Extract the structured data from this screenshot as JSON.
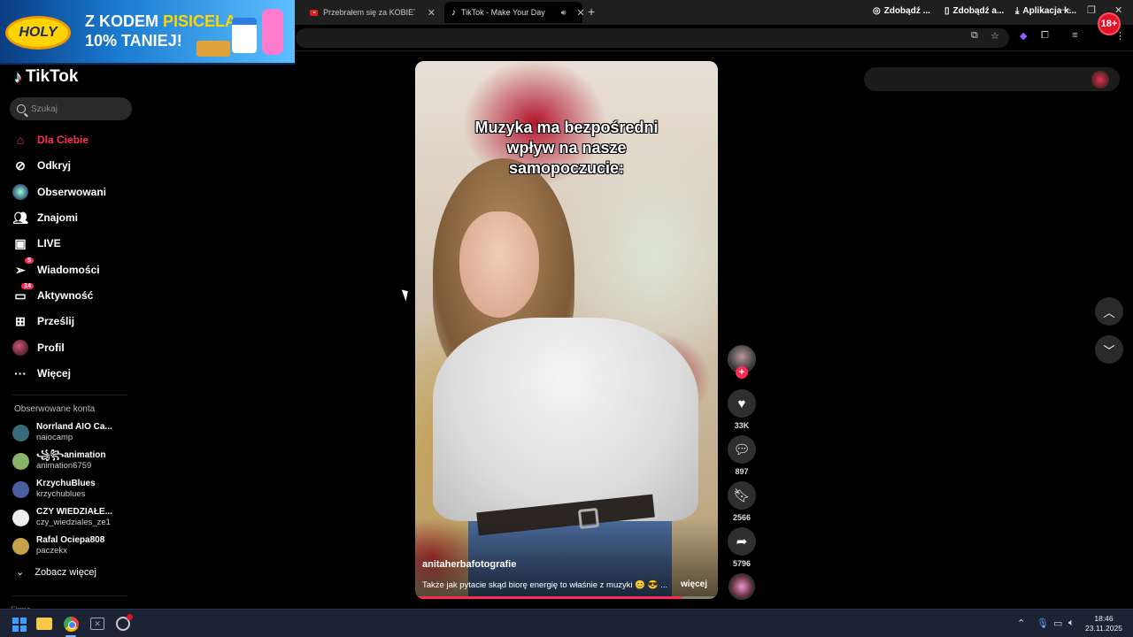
{
  "browser": {
    "tabs": [
      {
        "title": "Przebrałem się za KOBIETĘ na S",
        "icon": "youtube-icon"
      },
      {
        "title": "TikTok - Make Your Day",
        "icon": "tiktok-icon"
      }
    ]
  },
  "ad": {
    "brand": "HOLY",
    "line1_prefix": "Z KODEM",
    "line1_highlight": "PISICELA",
    "line2": "10% TANIEJ!",
    "age_badge": "18+"
  },
  "sidebar": {
    "logo": "TikTok",
    "search_placeholder": "Szukaj",
    "nav": [
      {
        "label": "Dla Ciebie",
        "icon": "home-icon",
        "active": true
      },
      {
        "label": "Odkryj",
        "icon": "compass-icon"
      },
      {
        "label": "Obserwowani",
        "icon": "following-avatar-icon"
      },
      {
        "label": "Znajomi",
        "icon": "friends-icon"
      },
      {
        "label": "LIVE",
        "icon": "live-icon"
      },
      {
        "label": "Wiadomości",
        "icon": "message-icon",
        "badge": "5"
      },
      {
        "label": "Aktywność",
        "icon": "activity-icon",
        "badge": "14"
      },
      {
        "label": "Prześlij",
        "icon": "upload-icon"
      },
      {
        "label": "Profil",
        "icon": "profile-avatar-icon"
      },
      {
        "label": "Więcej",
        "icon": "more-icon"
      }
    ],
    "followed_title": "Obserwowane konta",
    "followed": [
      {
        "name": "Norrland AIO Ca...",
        "handle": "naiocamp",
        "color": "#3a6b7a"
      },
      {
        "name": "꧁꧂animation",
        "handle": "animation6759",
        "color": "#8ab36a"
      },
      {
        "name": "KrzychuBlues",
        "handle": "krzychublues",
        "color": "#4a5fa0"
      },
      {
        "name": "CZY WIEDZIAŁE...",
        "handle": "czy_wiedziales_ze1",
        "color": "#eeeeee"
      },
      {
        "name": "Rafal Ociepa808",
        "handle": "paczekx",
        "color": "#c6a24a"
      }
    ],
    "see_more": "Zobacz więcej",
    "cut_label": "Firma"
  },
  "video": {
    "caption_lines": [
      "Muzyka ma bezpośredni",
      "wpływ na nasze",
      "samopoczucie:"
    ],
    "author": "anitaherbafotografie",
    "description": "Także jak pytacie skąd biorę energię to właśnie z muzyki 😊 😎 ...",
    "more_label": "więcej",
    "progress": 0.88
  },
  "actions": {
    "likes": "33K",
    "comments": "897",
    "saves": "2566",
    "shares": "5796"
  },
  "top_buttons": [
    {
      "label": "Zdobądź ...",
      "icon": "coin-icon"
    },
    {
      "label": "Zdobądź a...",
      "icon": "phone-icon"
    },
    {
      "label": "Aplikacja k...",
      "icon": "download-icon"
    }
  ],
  "taskbar": {
    "time": "18:46",
    "date": "23.11.2025"
  },
  "colors": {
    "accent": "#fe2c55",
    "background": "#000000"
  }
}
